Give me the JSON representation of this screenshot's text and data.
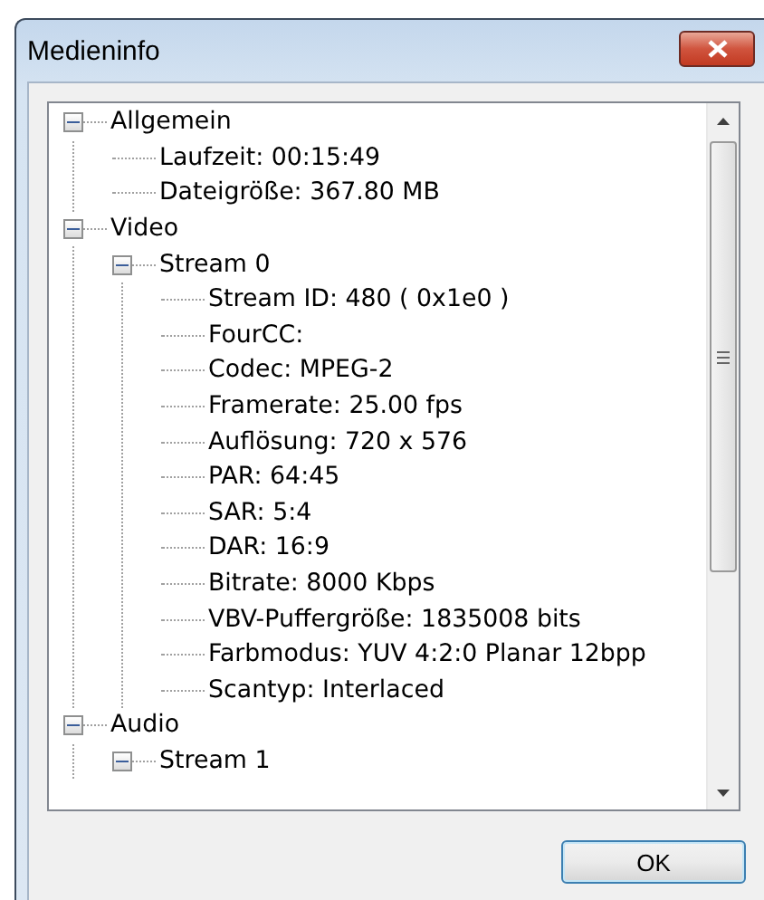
{
  "window": {
    "title": "Medieninfo"
  },
  "tree": [
    {
      "label": "Allgemein",
      "expanded": true,
      "children": [
        {
          "label": "Laufzeit: 00:15:49"
        },
        {
          "label": "Dateigröße: 367.80 MB"
        }
      ]
    },
    {
      "label": "Video",
      "expanded": true,
      "children": [
        {
          "label": "Stream 0",
          "expanded": true,
          "children": [
            {
              "label": "Stream ID: 480 ( 0x1e0 )"
            },
            {
              "label": "FourCC:"
            },
            {
              "label": "Codec: MPEG-2"
            },
            {
              "label": "Framerate: 25.00 fps"
            },
            {
              "label": "Auflösung: 720 x 576"
            },
            {
              "label": "PAR: 64:45"
            },
            {
              "label": "SAR: 5:4"
            },
            {
              "label": "DAR: 16:9"
            },
            {
              "label": "Bitrate: 8000 Kbps"
            },
            {
              "label": "VBV-Puffergröße: 1835008 bits"
            },
            {
              "label": "Farbmodus: YUV 4:2:0 Planar 12bpp"
            },
            {
              "label": "Scantyp: Interlaced"
            }
          ]
        }
      ]
    },
    {
      "label": "Audio",
      "expanded": true,
      "children": [
        {
          "label": "Stream 1",
          "expanded": true
        }
      ]
    }
  ],
  "buttons": [
    {
      "label": "OK"
    }
  ]
}
